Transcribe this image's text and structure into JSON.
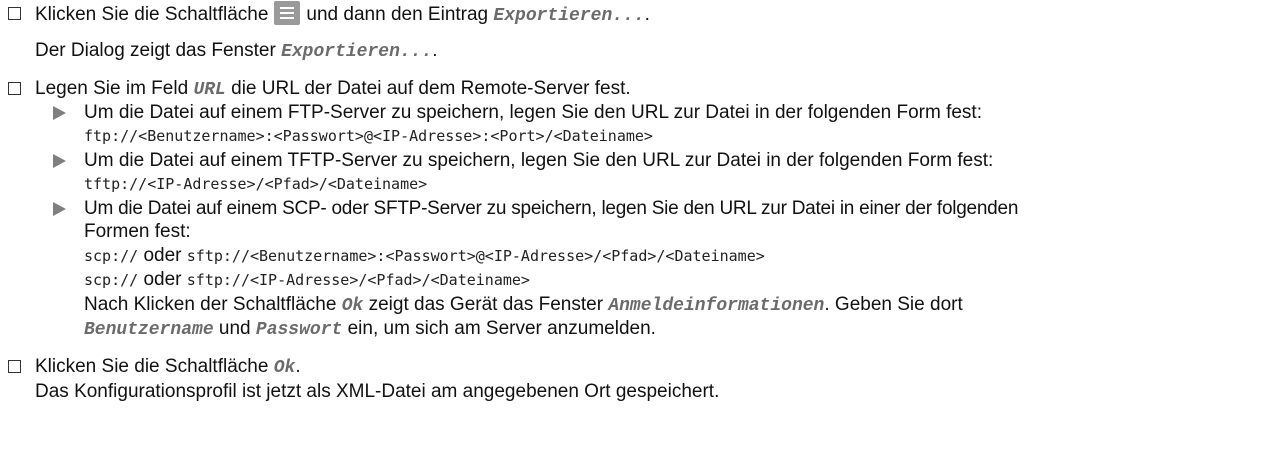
{
  "step1": {
    "pre": "Klicken Sie die Schaltfläche",
    "mid": "und dann den Eintrag",
    "item": "Exportieren...",
    "post": ".",
    "icon": "hamburger-menu-icon"
  },
  "step1_result": {
    "pre": "Der Dialog zeigt das Fenster",
    "item": "Exportieren...",
    "post": "."
  },
  "step2": {
    "pre": "Legen Sie im Feld",
    "field": "URL",
    "post": "die URL der Datei auf dem Remote-Server fest."
  },
  "ftp": {
    "text": "Um die Datei auf einem FTP-Server zu speichern, legen Sie den URL zur Datei in der folgenden Form fest:",
    "code": "ftp://<Benutzername>:<Passwort>@<IP-Adresse>:<Port>/<Dateiname>"
  },
  "tftp": {
    "text": "Um die Datei auf einem TFTP-Server zu speichern, legen Sie den URL zur Datei in der folgenden Form fest:",
    "code": "tftp://<IP-Adresse>/<Pfad>/<Dateiname>"
  },
  "scp": {
    "text1": "Um die Datei auf einem SCP- oder SFTP-Server zu speichern, legen Sie den URL zur Datei in einer der folgenden",
    "text2": "Formen fest:",
    "code1a": "scp://",
    "or": "oder",
    "code1b": "sftp://<Benutzername>:<Passwort>@<IP-Adresse>/<Pfad>/<Dateiname>",
    "code2a": "scp://",
    "code2b": "sftp://<IP-Adresse>/<Pfad>/<Dateiname>",
    "note1_pre": "Nach Klicken der Schaltfläche",
    "note1_btn": "Ok",
    "note1_mid": "zeigt das Gerät das Fenster",
    "note1_win": "Anmeldeinformationen",
    "note1_post": ". Geben Sie dort",
    "note2_user": "Benutzername",
    "note2_and": "und",
    "note2_pass": "Passwort",
    "note2_post": "ein, um sich am Server anzumelden."
  },
  "step3": {
    "pre": "Klicken Sie die Schaltfläche",
    "btn": "Ok",
    "post": "."
  },
  "step3_result": "Das Konfigurationsprofil ist jetzt als XML-Datei am angegebenen Ort gespeichert."
}
